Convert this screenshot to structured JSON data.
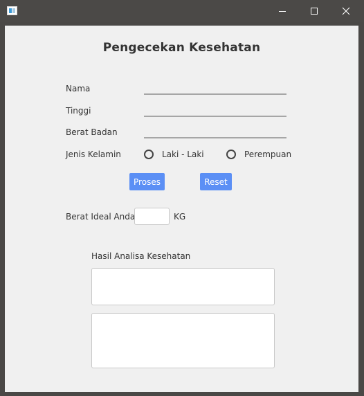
{
  "window": {
    "title": "",
    "controls": {
      "minimize_icon": "minimize-icon",
      "maximize_icon": "maximize-icon",
      "close_icon": "close-icon"
    }
  },
  "form": {
    "heading": "Pengecekan Kesehatan",
    "name_label": "Nama",
    "name_value": "",
    "height_label": "Tinggi",
    "height_value": "",
    "weight_label": "Berat Badan",
    "weight_value": "",
    "gender_label": "Jenis Kelamin",
    "gender_options": [
      "Laki - Laki",
      "Perempuan"
    ],
    "gender_selected": null
  },
  "actions": {
    "process_label": "Proses",
    "reset_label": "Reset"
  },
  "result": {
    "ideal_weight_label": "Berat Ideal Anda",
    "ideal_weight_value": "",
    "ideal_weight_unit": "KG",
    "analysis_label": "Hasil Analisa Kesehatan",
    "analysis_text_1": "",
    "analysis_text_2": ""
  },
  "colors": {
    "button_bg": "#5b8ff5",
    "panel_bg": "#f0f0f0",
    "frame_bg": "#4a4846"
  }
}
